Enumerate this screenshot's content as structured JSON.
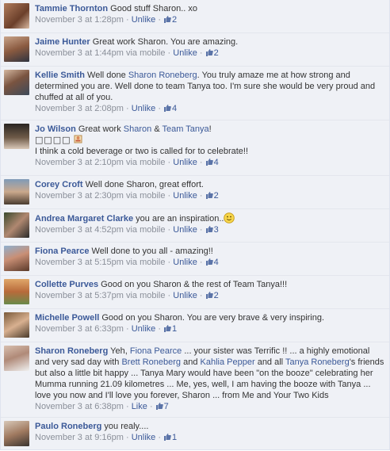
{
  "ui": {
    "unlike": "Unlike",
    "like": "Like",
    "sep": "·"
  },
  "comments": [
    {
      "author": "Tammie Thornton",
      "text": [
        "Good stuff Sharon.. xo"
      ],
      "time": "November 3 at 1:28pm",
      "mobile": "",
      "action": "Unlike",
      "likes": "2"
    },
    {
      "author": "Jaime Hunter",
      "text": [
        "Great work Sharon. You are amazing."
      ],
      "time": "November 3 at 1:44pm",
      "mobile": "via mobile",
      "action": "Unlike",
      "likes": "2"
    },
    {
      "author": "Kellie Smith",
      "text": [
        "Well done ",
        "Sharon Roneberg",
        ". You truly amaze me at how strong and determined you are. Well done to team Tanya too. I'm sure she would be very proud and chuffed at all of you."
      ],
      "time": "November 3 at 2:08pm",
      "mobile": "",
      "action": "Unlike",
      "likes": "4"
    },
    {
      "author": "Jo Wilson",
      "text": [
        "Great work ",
        "Sharon",
        " & ",
        "Team Tanya",
        "!"
      ],
      "extra_line1": "□□□□",
      "extra_line2": "I think a cold beverage or two is called for to celebrate!!",
      "time": "November 3 at 2:10pm",
      "mobile": "via mobile",
      "action": "Unlike",
      "likes": "4"
    },
    {
      "author": "Corey Croft",
      "text": [
        "Well done Sharon, great effort."
      ],
      "time": "November 3 at 2:30pm",
      "mobile": "via mobile",
      "action": "Unlike",
      "likes": "2"
    },
    {
      "author": "Andrea Margaret Clarke",
      "text": [
        "you are an inspiration.."
      ],
      "time": "November 3 at 4:52pm",
      "mobile": "via mobile",
      "action": "Unlike",
      "likes": "3"
    },
    {
      "author": "Fiona Pearce",
      "text": [
        "Well done to you all - amazing!!"
      ],
      "time": "November 3 at 5:15pm",
      "mobile": "via mobile",
      "action": "Unlike",
      "likes": "4"
    },
    {
      "author": "Collette Purves",
      "text": [
        "Good on you Sharon & the rest of Team Tanya!!!"
      ],
      "time": "November 3 at 5:37pm",
      "mobile": "via mobile",
      "action": "Unlike",
      "likes": "2"
    },
    {
      "author": "Michelle Powell",
      "text": [
        "Good on you Sharon. You are very brave & very inspiring."
      ],
      "time": "November 3 at 6:33pm",
      "mobile": "",
      "action": "Unlike",
      "likes": "1"
    },
    {
      "author": "Sharon Roneberg",
      "text": [
        "Yeh, ",
        "Fiona Pearce",
        " ... your sister was Terrific !! ... a highly emotional and very sad day with ",
        "Brett Roneberg",
        " and ",
        "Kahlia Pepper",
        " and all ",
        "Tanya Roneberg",
        "'s friends but also a little bit happy ... Tanya Mary would have been \"on the booze\" celebrating her Mumma running 21.09 kilometres ... Me, yes, well, I am having the booze with Tanya ... love you now and I'll love you forever, Sharon ... from Me and Your Two Kids"
      ],
      "time": "November 3 at 6:38pm",
      "mobile": "",
      "action": "Like",
      "likes": "7"
    },
    {
      "author": "Paulo Roneberg",
      "text": [
        "you realy...."
      ],
      "time": "November 3 at 9:16pm",
      "mobile": "",
      "action": "Unlike",
      "likes": "1"
    }
  ]
}
